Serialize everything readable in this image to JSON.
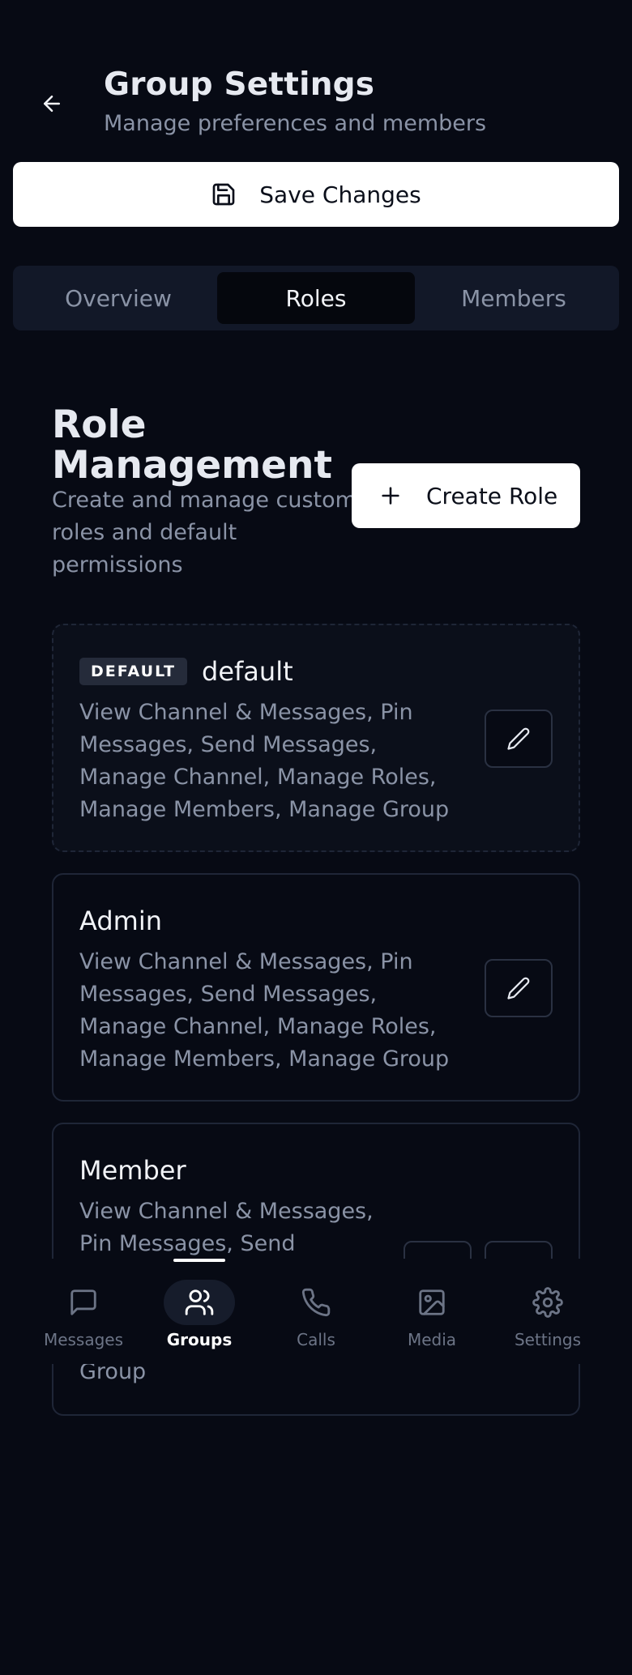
{
  "header": {
    "title": "Group Settings",
    "subtitle": "Manage preferences and members"
  },
  "toolbar": {
    "save_label": "Save Changes"
  },
  "tabs": [
    {
      "label": "Overview",
      "active": false
    },
    {
      "label": "Roles",
      "active": true
    },
    {
      "label": "Members",
      "active": false
    }
  ],
  "roles_section": {
    "title": "Role Management",
    "description": "Create and manage custom roles and default permissions",
    "create_label": "Create Role"
  },
  "roles": [
    {
      "badge": "DEFAULT",
      "name": "default",
      "permissions": "View Channel & Messages, Pin Messages, Send Messages, Manage Channel, Manage Roles, Manage Members, Manage Group"
    },
    {
      "name": "Admin",
      "permissions": "View Channel & Messages, Pin Messages, Send Messages, Manage Channel, Manage Roles, Manage Members, Manage Group"
    },
    {
      "name": "Member",
      "permissions_visible_top": "View Channel & Messages, Pin Messages, Send",
      "permissions_visible_bottom": "Group"
    }
  ],
  "nav": [
    {
      "label": "Messages",
      "icon": "message-icon",
      "active": false
    },
    {
      "label": "Groups",
      "icon": "users-icon",
      "active": true
    },
    {
      "label": "Calls",
      "icon": "phone-icon",
      "active": false
    },
    {
      "label": "Media",
      "icon": "image-icon",
      "active": false
    },
    {
      "label": "Settings",
      "icon": "gear-icon",
      "active": false
    }
  ],
  "colors": {
    "background": "#070a14",
    "surface": "#121828",
    "muted_text": "#8a93a6",
    "delete_accent": "#e11d28"
  }
}
